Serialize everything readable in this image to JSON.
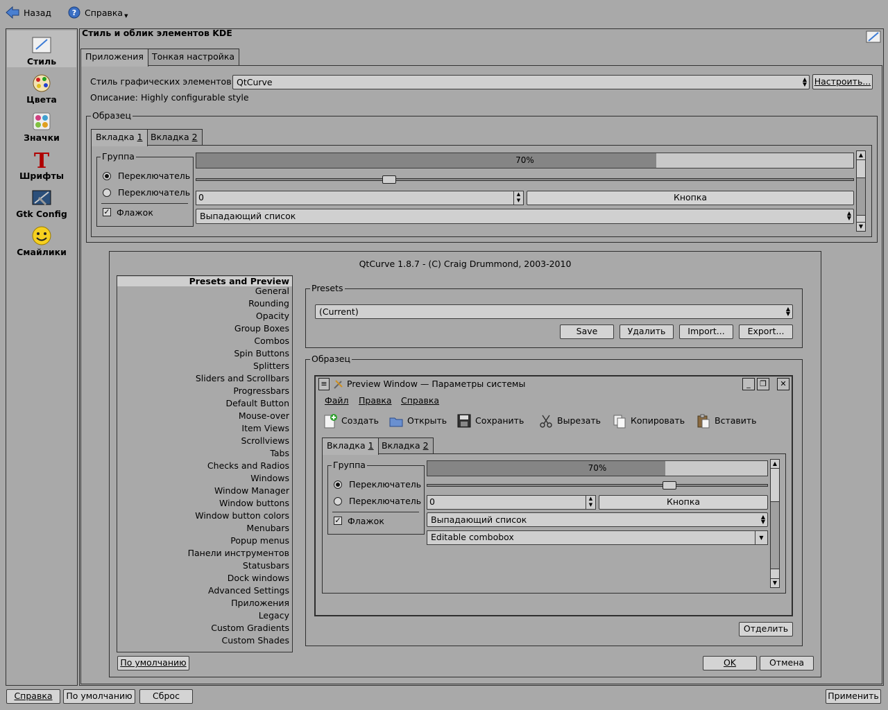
{
  "toolbar": {
    "back_label": "Назад",
    "help_label": "Справка"
  },
  "sidebar": {
    "items": [
      {
        "label": "Стиль",
        "icon": "style-icon"
      },
      {
        "label": "Цвета",
        "icon": "colors-icon"
      },
      {
        "label": "Значки",
        "icon": "icons-icon"
      },
      {
        "label": "Шрифты",
        "icon": "fonts-icon"
      },
      {
        "label": "Gtk Config",
        "icon": "gtk-icon"
      },
      {
        "label": "Смайлики",
        "icon": "smiley-icon"
      }
    ]
  },
  "header": {
    "title": "Стиль и облик элементов KDE"
  },
  "tabs": [
    {
      "label": "Приложения"
    },
    {
      "label": "Тонкая настройка"
    }
  ],
  "style_row": {
    "label": "Стиль графических элементов:",
    "value": "QtCurve",
    "configure_label": "Настроить..."
  },
  "description": {
    "label": "Описание:",
    "value": "Highly configurable style"
  },
  "sample": {
    "legend": "Образец",
    "tabs": [
      {
        "pre": "Вкладка ",
        "key": "1"
      },
      {
        "pre": "Вкладка ",
        "key": "2"
      }
    ],
    "group": "Группа",
    "radio1": "Переключатель",
    "radio2": "Переключатель",
    "checkbox": "Флажок",
    "progress_text": "70%",
    "progress_value": 0.7,
    "slider_value": 0.29,
    "spin_value": "0",
    "button": "Кнопка",
    "combo": "Выпадающий список"
  },
  "qtcurve": {
    "header": "QtCurve 1.8.7 - (C) Craig Drummond, 2003-2010",
    "categories": [
      "Presets and Preview",
      "General",
      "Rounding",
      "Opacity",
      "Group Boxes",
      "Combos",
      "Spin Buttons",
      "Splitters",
      "Sliders and Scrollbars",
      "Progressbars",
      "Default Button",
      "Mouse-over",
      "Item Views",
      "Scrollviews",
      "Tabs",
      "Checks and Radios",
      "Windows",
      "Window Manager",
      "Window buttons",
      "Window button colors",
      "Menubars",
      "Popup menus",
      "Панели инструментов",
      "Statusbars",
      "Dock windows",
      "Advanced Settings",
      "Приложения",
      "Legacy",
      "Custom Gradients",
      "Custom Shades"
    ],
    "presets": {
      "legend": "Presets",
      "value": "(Current)",
      "save": "Save",
      "delete": "Удалить",
      "import": "Import...",
      "export": "Export..."
    },
    "preview": {
      "legend": "Образец",
      "window_title": "Preview Window — Параметры системы",
      "menu": [
        "Файл",
        "Правка",
        "Справка"
      ],
      "tools": [
        "Создать",
        "Открыть",
        "Сохранить",
        "Вырезать",
        "Копировать",
        "Вставить"
      ],
      "tabs": [
        {
          "pre": "Вкладка ",
          "key": "1"
        },
        {
          "pre": "Вкладка ",
          "key": "2"
        }
      ],
      "group": "Группа",
      "radio1": "Переключатель",
      "radio2": "Переключатель",
      "checkbox": "Флажок",
      "progress_text": "70%",
      "progress_value": 0.7,
      "slider_value": 0.72,
      "spin_value": "0",
      "button": "Кнопка",
      "combo": "Выпадающий список",
      "editable_combo": "Editable combobox",
      "detach": "Отделить"
    },
    "defaults": "По умолчанию",
    "ok": "OK",
    "cancel": "Отмена"
  },
  "bottom": {
    "help": "Справка",
    "defaults": "По умолчанию",
    "reset": "Сброс",
    "apply": "Применить"
  }
}
